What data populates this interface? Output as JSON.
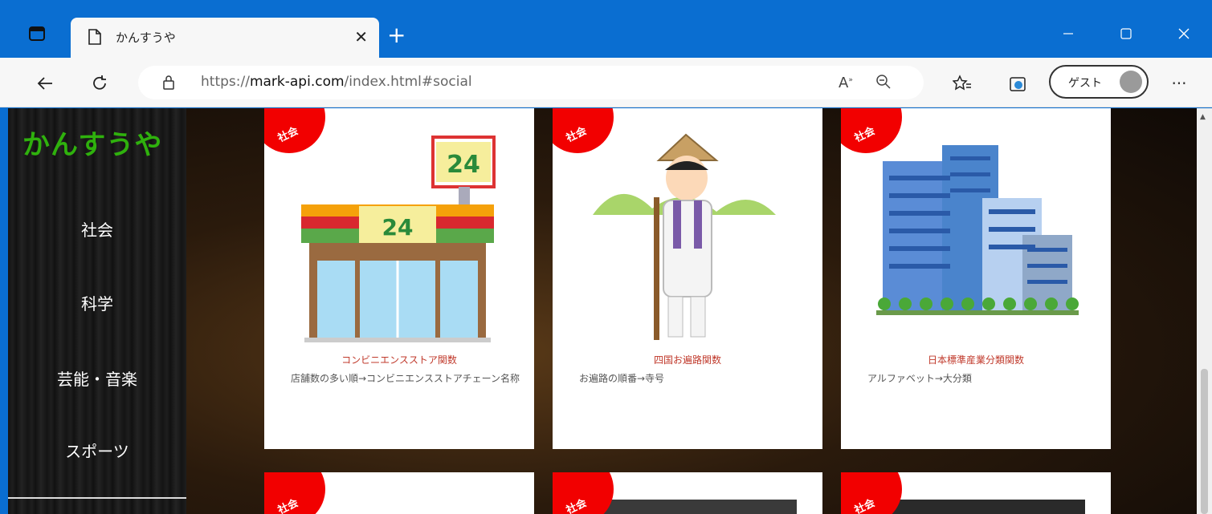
{
  "browser": {
    "tab_title": "かんすうや",
    "url_scheme": "https://",
    "url_host": "mark-api.com",
    "url_path": "/index.html#social",
    "profile_label": "ゲスト",
    "icons": [
      "tab-actions-icon",
      "page-icon",
      "close-icon",
      "new-tab-icon",
      "minimize-icon",
      "maximize-icon",
      "close-window-icon",
      "back-icon",
      "refresh-icon",
      "lock-icon",
      "read-aloud-icon",
      "zoom-icon",
      "favorites-icon",
      "collections-icon",
      "avatar-icon",
      "more-icon"
    ]
  },
  "site": {
    "logo": "かんすうや",
    "nav": [
      "社会",
      "科学",
      "芸能・音楽",
      "スポーツ"
    ]
  },
  "cards": [
    {
      "badge": "社会",
      "title": "コンビニエンスストア関数",
      "desc": "店舗数の多い順→コンビニエンスストアチェーン名称",
      "image": "convenience-store-illustration"
    },
    {
      "badge": "社会",
      "title": "四国お遍路関数",
      "desc": "お遍路の順番→寺号",
      "image": "pilgrim-illustration"
    },
    {
      "badge": "社会",
      "title": "日本標準産業分類関数",
      "desc": "アルファベット→大分類",
      "image": "office-buildings-illustration"
    },
    {
      "badge": "社会",
      "image": "card-image"
    },
    {
      "badge": "社会",
      "image": "card-image-photo"
    },
    {
      "badge": "社会",
      "image": "card-image-photo"
    }
  ],
  "colors": {
    "titlebar": "#0a6ed1",
    "logo": "#2fb10d",
    "badge": "#f20000",
    "card_title": "#c0392b"
  }
}
